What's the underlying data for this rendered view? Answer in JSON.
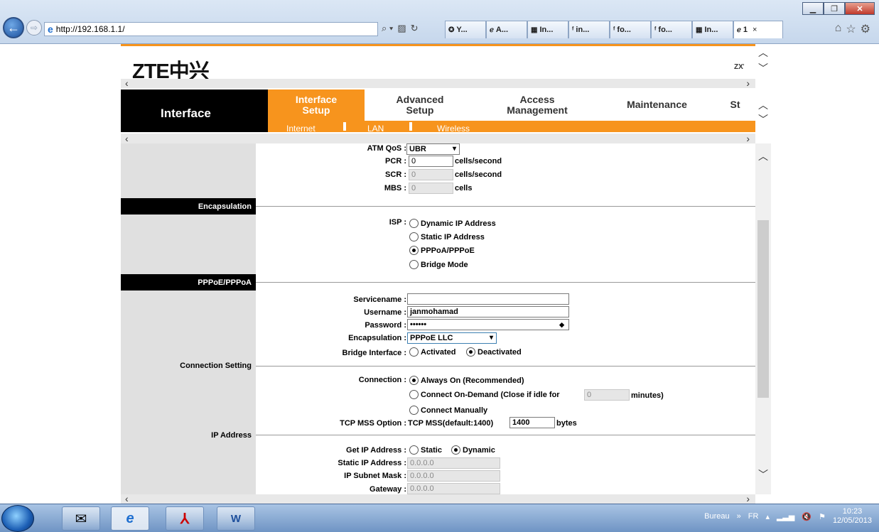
{
  "browser": {
    "address": "http://192.168.1.1/",
    "search_icon": "search-icon",
    "tabs": [
      {
        "icon": "yahoo-icon",
        "label": "Y..."
      },
      {
        "icon": "ie-icon",
        "label": "A..."
      },
      {
        "icon": "windows-icon",
        "label": "In..."
      },
      {
        "icon": "forum-icon",
        "label": "in..."
      },
      {
        "icon": "forum-icon",
        "label": "fo..."
      },
      {
        "icon": "forum-icon",
        "label": "fo..."
      },
      {
        "icon": "windows-icon",
        "label": "In..."
      },
      {
        "icon": "ie-icon",
        "label": "1"
      }
    ],
    "active_tab_close": "×"
  },
  "router": {
    "logo_latin": "ZTE",
    "logo_cjk": "中兴",
    "logo_right_partial": "ZXV"
  },
  "nav": {
    "section_title": "Interface",
    "tabs": [
      {
        "label1": "Interface",
        "label2": "Setup",
        "active": true
      },
      {
        "label1": "Advanced",
        "label2": "Setup",
        "active": false
      },
      {
        "label1": "Access",
        "label2": "Management",
        "active": false
      },
      {
        "label1": "Maintenance",
        "label2": "",
        "active": false
      },
      {
        "label1": "St",
        "label2": "",
        "active": false
      }
    ],
    "subtabs": [
      "Internet",
      "LAN",
      "Wireless"
    ]
  },
  "atm": {
    "qos_label": "ATM QoS :",
    "qos_value": "UBR",
    "pcr_label": "PCR :",
    "pcr_value": "0",
    "pcr_unit": "cells/second",
    "scr_label": "SCR :",
    "scr_value": "0",
    "scr_unit": "cells/second",
    "mbs_label": "MBS :",
    "mbs_value": "0",
    "mbs_unit": "cells"
  },
  "encapsulation": {
    "header": "Encapsulation",
    "isp_label": "ISP :",
    "options": [
      {
        "label": "Dynamic IP Address",
        "selected": false
      },
      {
        "label": "Static IP Address",
        "selected": false
      },
      {
        "label": "PPPoA/PPPoE",
        "selected": true
      },
      {
        "label": "Bridge Mode",
        "selected": false
      }
    ]
  },
  "pppoe": {
    "header": "PPPoE/PPPoA",
    "servicename_label": "Servicename :",
    "servicename_value": "",
    "username_label": "Username :",
    "username_value": "janmohamad",
    "password_label": "Password :",
    "password_value": "••••••",
    "encap_label": "Encapsulation :",
    "encap_value": "PPPoE LLC",
    "bridge_label": "Bridge Interface :",
    "bridge_activated": "Activated",
    "bridge_deactivated": "Deactivated",
    "bridge_selected": "Deactivated"
  },
  "connection": {
    "header": "Connection Setting",
    "label": "Connection :",
    "always_on": "Always On (Recommended)",
    "on_demand": "Connect On-Demand (Close if idle for",
    "idle_value": "0",
    "idle_unit": "minutes)",
    "manual": "Connect Manually",
    "selected": "always_on",
    "tcp_label": "TCP MSS Option :",
    "tcp_text": "TCP MSS(default:1400)",
    "tcp_value": "1400",
    "tcp_unit": "bytes"
  },
  "ip": {
    "header": "IP Address",
    "get_label": "Get IP Address :",
    "static": "Static",
    "dynamic": "Dynamic",
    "selected": "Dynamic",
    "static_ip_label": "Static IP Address :",
    "static_ip_value": "0.0.0.0",
    "mask_label": "IP Subnet Mask :",
    "mask_value": "0.0.0.0",
    "gateway_label": "Gateway :",
    "gateway_value": "0.0.0.0"
  },
  "taskbar": {
    "desktop_label": "Bureau",
    "lang": "FR",
    "time": "10:23",
    "date": "12/05/2013"
  }
}
